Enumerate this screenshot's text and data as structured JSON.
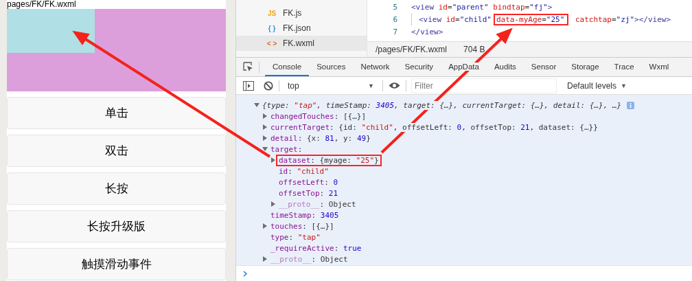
{
  "simulator": {
    "page_path": "pages/FK/FK.wxml",
    "buttons": [
      {
        "label": "单击"
      },
      {
        "label": "双击"
      },
      {
        "label": "长按"
      },
      {
        "label": "长按升级版"
      },
      {
        "label": "触摸滑动事件"
      }
    ]
  },
  "file_tree": [
    {
      "icon": "JS",
      "name": "FK.js",
      "kind": "js",
      "selected": false
    },
    {
      "icon": "{ }",
      "name": "FK.json",
      "kind": "json",
      "selected": false
    },
    {
      "icon": "< >",
      "name": "FK.wxml",
      "kind": "wxml",
      "selected": true
    }
  ],
  "editor": {
    "lines": [
      {
        "number": "5",
        "guide": false,
        "tokens": [
          {
            "kind": "tag",
            "text": "<view "
          },
          {
            "kind": "attr",
            "text": "id"
          },
          {
            "kind": "plain",
            "text": "="
          },
          {
            "kind": "value",
            "text": "\"parent\" "
          },
          {
            "kind": "attr",
            "text": "bindtap"
          },
          {
            "kind": "plain",
            "text": "="
          },
          {
            "kind": "value",
            "text": "\"fj\""
          },
          {
            "kind": "tag",
            "text": ">"
          }
        ]
      },
      {
        "number": "6",
        "guide": true,
        "tokens": [
          {
            "kind": "tag",
            "text": "<view "
          },
          {
            "kind": "attr",
            "text": "id"
          },
          {
            "kind": "plain",
            "text": "="
          },
          {
            "kind": "value",
            "text": "\"child\""
          },
          {
            "kind": "group",
            "highlighted": true,
            "tokens": [
              {
                "kind": "attr",
                "text": "data-myAge"
              },
              {
                "kind": "plain",
                "text": "="
              },
              {
                "kind": "value",
                "text": "\"25\""
              }
            ]
          },
          {
            "kind": "attr",
            "text": " catchtap"
          },
          {
            "kind": "plain",
            "text": "="
          },
          {
            "kind": "value",
            "text": "\"zj\""
          },
          {
            "kind": "tag",
            "text": "></view>"
          }
        ]
      },
      {
        "number": "7",
        "guide": false,
        "tokens": [
          {
            "kind": "tag",
            "text": "</view>"
          }
        ]
      }
    ],
    "status": {
      "path": "/pages/FK/FK.wxml",
      "size": "704 B"
    }
  },
  "devtools": {
    "tabs": [
      {
        "label": "Console",
        "selected": true
      },
      {
        "label": "Sources",
        "selected": false
      },
      {
        "label": "Network",
        "selected": false
      },
      {
        "label": "Security",
        "selected": false
      },
      {
        "label": "AppData",
        "selected": false
      },
      {
        "label": "Audits",
        "selected": false
      },
      {
        "label": "Sensor",
        "selected": false
      },
      {
        "label": "Storage",
        "selected": false
      },
      {
        "label": "Trace",
        "selected": false
      },
      {
        "label": "Wxml",
        "selected": false
      }
    ],
    "toolbar": {
      "context": "top",
      "context_caret": "▼",
      "filter_placeholder": "Filter",
      "levels": "Default levels",
      "levels_caret": "▼"
    },
    "console": [
      {
        "kind": "summary",
        "expanded": true,
        "info": true,
        "highlighted": false,
        "parts": [
          {
            "kind": "plain",
            "text": "{type: "
          },
          {
            "kind": "str",
            "text": "\"tap\""
          },
          {
            "kind": "plain",
            "text": ", timeStamp: "
          },
          {
            "kind": "num",
            "text": "3405"
          },
          {
            "kind": "plain",
            "text": ", target: {…}, currentTarget: {…}, detail: {…}, …}"
          }
        ],
        "children": [
          {
            "kind": "entry",
            "expanded": false,
            "highlighted": false,
            "parts": [
              {
                "kind": "key",
                "text": "changedTouches"
              },
              {
                "kind": "plain",
                "text": ": [{…}]"
              }
            ]
          },
          {
            "kind": "entry",
            "expanded": false,
            "highlighted": false,
            "parts": [
              {
                "kind": "key",
                "text": "currentTarget"
              },
              {
                "kind": "plain",
                "text": ": {id: "
              },
              {
                "kind": "str",
                "text": "\"child\""
              },
              {
                "kind": "plain",
                "text": ", offsetLeft: "
              },
              {
                "kind": "num",
                "text": "0"
              },
              {
                "kind": "plain",
                "text": ", offsetTop: "
              },
              {
                "kind": "num",
                "text": "21"
              },
              {
                "kind": "plain",
                "text": ", dataset: {…}}"
              }
            ]
          },
          {
            "kind": "entry",
            "expanded": false,
            "highlighted": false,
            "parts": [
              {
                "kind": "key",
                "text": "detail"
              },
              {
                "kind": "plain",
                "text": ": {x: "
              },
              {
                "kind": "num",
                "text": "81"
              },
              {
                "kind": "plain",
                "text": ", y: "
              },
              {
                "kind": "num",
                "text": "49"
              },
              {
                "kind": "plain",
                "text": "}"
              }
            ]
          },
          {
            "kind": "entry",
            "expanded": true,
            "highlighted": false,
            "parts": [
              {
                "kind": "key",
                "text": "target"
              },
              {
                "kind": "plain",
                "text": ":"
              }
            ],
            "children": [
              {
                "kind": "entry",
                "expanded": false,
                "highlighted": true,
                "parts": [
                  {
                    "kind": "key",
                    "text": "dataset"
                  },
                  {
                    "kind": "plain",
                    "text": ": {myage: "
                  },
                  {
                    "kind": "str",
                    "text": "\"25\""
                  },
                  {
                    "kind": "plain",
                    "text": "}"
                  }
                ]
              },
              {
                "kind": "leaf",
                "highlighted": false,
                "parts": [
                  {
                    "kind": "key",
                    "text": "id"
                  },
                  {
                    "kind": "plain",
                    "text": ": "
                  },
                  {
                    "kind": "str",
                    "text": "\"child\""
                  }
                ]
              },
              {
                "kind": "leaf",
                "highlighted": false,
                "parts": [
                  {
                    "kind": "key",
                    "text": "offsetLeft"
                  },
                  {
                    "kind": "plain",
                    "text": ": "
                  },
                  {
                    "kind": "num",
                    "text": "0"
                  }
                ]
              },
              {
                "kind": "leaf",
                "highlighted": false,
                "parts": [
                  {
                    "kind": "key",
                    "text": "offsetTop"
                  },
                  {
                    "kind": "plain",
                    "text": ": "
                  },
                  {
                    "kind": "num",
                    "text": "21"
                  }
                ]
              },
              {
                "kind": "entry",
                "expanded": false,
                "highlighted": false,
                "parts": [
                  {
                    "kind": "proto",
                    "text": "__proto__"
                  },
                  {
                    "kind": "plain",
                    "text": ": Object"
                  }
                ]
              }
            ]
          },
          {
            "kind": "leaf",
            "highlighted": false,
            "parts": [
              {
                "kind": "key",
                "text": "timeStamp"
              },
              {
                "kind": "plain",
                "text": ": "
              },
              {
                "kind": "num",
                "text": "3405"
              }
            ]
          },
          {
            "kind": "entry",
            "expanded": false,
            "highlighted": false,
            "parts": [
              {
                "kind": "key",
                "text": "touches"
              },
              {
                "kind": "plain",
                "text": ": [{…}]"
              }
            ]
          },
          {
            "kind": "leaf",
            "highlighted": false,
            "parts": [
              {
                "kind": "key",
                "text": "type"
              },
              {
                "kind": "plain",
                "text": ": "
              },
              {
                "kind": "str",
                "text": "\"tap\""
              }
            ]
          },
          {
            "kind": "leaf",
            "highlighted": false,
            "parts": [
              {
                "kind": "key",
                "text": "_requireActive"
              },
              {
                "kind": "plain",
                "text": ": "
              },
              {
                "kind": "num",
                "text": "true"
              }
            ]
          },
          {
            "kind": "entry",
            "expanded": false,
            "highlighted": false,
            "parts": [
              {
                "kind": "proto",
                "text": "__proto__"
              },
              {
                "kind": "plain",
                "text": ": Object"
              }
            ]
          }
        ]
      }
    ]
  }
}
